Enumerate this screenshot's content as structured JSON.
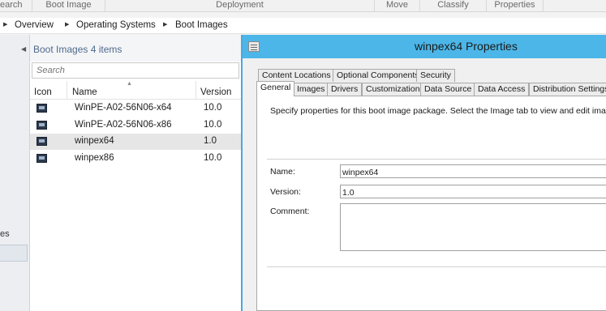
{
  "ribbon": {
    "groups": [
      "earch",
      "Boot Image",
      "Deployment",
      "Move",
      "Classify",
      "Properties"
    ]
  },
  "breadcrumb": {
    "items": [
      "Overview",
      "Operating Systems",
      "Boot Images"
    ]
  },
  "left_nav": {
    "partial_label": "es"
  },
  "list": {
    "title": "Boot Images 4 items",
    "search_placeholder": "Search",
    "columns": [
      "Icon",
      "Name",
      "Version"
    ],
    "rows": [
      {
        "name": "WinPE-A02-56N06-x64",
        "version": "10.0",
        "selected": false
      },
      {
        "name": "WinPE-A02-56N06-x86",
        "version": "10.0",
        "selected": false
      },
      {
        "name": "winpex64",
        "version": "1.0",
        "selected": true
      },
      {
        "name": "winpex86",
        "version": "10.0",
        "selected": false
      }
    ]
  },
  "dialog": {
    "title": "winpex64 Properties",
    "tabs_row1": [
      "Content Locations",
      "Optional Components",
      "Security"
    ],
    "tabs_row2": [
      "General",
      "Images",
      "Drivers",
      "Customization",
      "Data Source",
      "Data Access",
      "Distribution Settings"
    ],
    "active_tab": "General",
    "description": "Specify properties for this boot image package. Select the Image tab to view and edit image pro",
    "fields": {
      "name_label": "Name:",
      "name_value": "winpex64",
      "version_label": "Version:",
      "version_value": "1.0",
      "comment_label": "Comment:",
      "comment_value": ""
    }
  },
  "colors": {
    "title_bar": "#4cb6e8",
    "list_title": "#4f6a8c",
    "selected_row": "#e6e6e6"
  }
}
